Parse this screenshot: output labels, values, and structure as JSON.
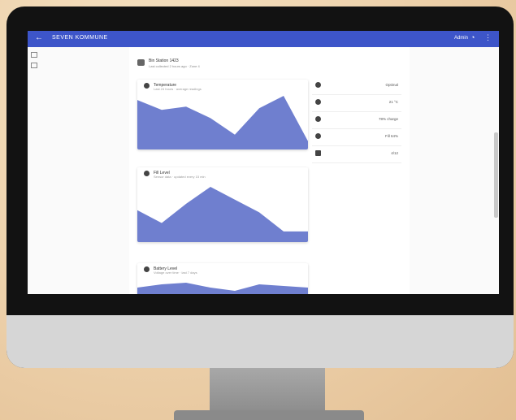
{
  "window": {
    "back_icon": "arrow-left-icon",
    "title": "SEVEN KOMMUNE",
    "user": "Admin"
  },
  "header": {
    "name": "Bin Station 1423",
    "subtitle": "Last collected 2 hours ago · Zone 4"
  },
  "stats": [
    {
      "icon": "signal-icon",
      "value": "Optimal"
    },
    {
      "icon": "thermometer-icon",
      "value": "21 °C"
    },
    {
      "icon": "battery-icon",
      "value": "78% charge"
    },
    {
      "icon": "fill-level-icon",
      "value": "Fill 64%"
    },
    {
      "icon": "calendar-icon",
      "value": "4/12"
    }
  ],
  "cards": [
    {
      "title": "Temperature",
      "subtitle": "Last 24 hours · average readings",
      "series": [
        60,
        48,
        52,
        38,
        18,
        50,
        65,
        10
      ]
    },
    {
      "title": "Fill Level",
      "subtitle": "Sensor data · updated every 15 min",
      "series": [
        30,
        18,
        36,
        52,
        40,
        28,
        10,
        10
      ]
    },
    {
      "title": "Battery Level",
      "subtitle": "Voltage over time · last 7 days",
      "series": [
        10,
        12,
        13,
        10,
        8,
        12,
        11,
        10
      ]
    }
  ]
}
